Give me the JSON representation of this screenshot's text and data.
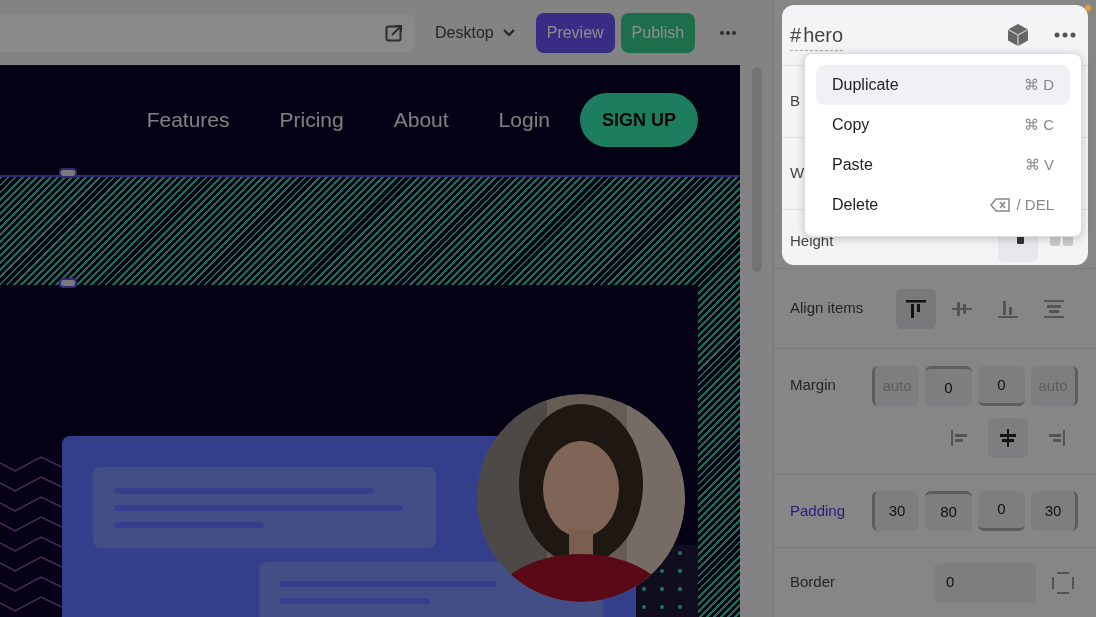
{
  "toolbar": {
    "device": "Desktop",
    "buttons": [
      {
        "label": "Preview",
        "kind": "preview"
      },
      {
        "label": "Publish",
        "kind": "publish"
      }
    ]
  },
  "site_nav": {
    "links": [
      "Features",
      "Pricing",
      "About",
      "Login"
    ],
    "cta": "SIGN UP"
  },
  "panel": {
    "element": {
      "symbol": "#",
      "name": "hero"
    },
    "menu": [
      {
        "label": "Duplicate",
        "shortcut": "⌘ D",
        "selected": true,
        "key_icon": false
      },
      {
        "label": "Copy",
        "shortcut": "⌘ C",
        "selected": false,
        "key_icon": false
      },
      {
        "label": "Paste",
        "shortcut": "⌘ V",
        "selected": false,
        "key_icon": false
      },
      {
        "label": "Delete",
        "shortcut": "/ DEL",
        "selected": false,
        "key_icon": true
      }
    ],
    "hidden_rows": [
      "B",
      "W"
    ],
    "height": {
      "label": "Height"
    },
    "align_items": {
      "label": "Align items",
      "options": [
        {
          "kind": "top",
          "selected": true
        },
        {
          "kind": "center",
          "selected": false
        },
        {
          "kind": "bottom",
          "selected": false
        },
        {
          "kind": "stretch",
          "selected": false
        }
      ]
    },
    "margin": {
      "label": "Margin",
      "values": [
        {
          "placeholder": "auto"
        },
        {
          "value": "0"
        },
        {
          "value": "0"
        },
        {
          "placeholder": "auto"
        }
      ],
      "alignment": [
        {
          "kind": "left",
          "selected": false
        },
        {
          "kind": "center",
          "selected": true
        },
        {
          "kind": "right",
          "selected": false
        }
      ]
    },
    "padding": {
      "label": "Padding",
      "highlighted": true,
      "values": [
        "30",
        "80",
        "0",
        "30"
      ]
    },
    "border": {
      "label": "Border",
      "value": "0"
    }
  }
}
